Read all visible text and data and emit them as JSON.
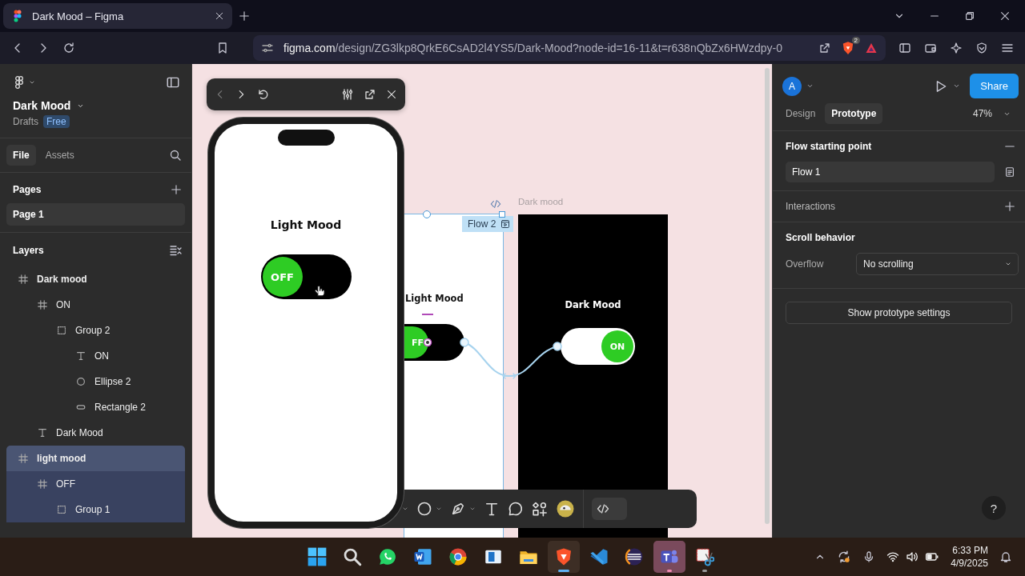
{
  "browser": {
    "tab": {
      "title": "Dark Mood – Figma",
      "selected": true
    },
    "url": {
      "host": "figma.com",
      "path": "/design/ZG3lkp8QrkE6CsAD2l4YS5/Dark-Mood?node-id=16-11&t=r638nQbZx6HWzdpy-0"
    },
    "shield_count": "2"
  },
  "file": {
    "name": "Dark Mood",
    "location": "Drafts",
    "plan": "Free"
  },
  "panel_tabs": [
    {
      "label": "File",
      "selected": true
    },
    {
      "label": "Assets",
      "selected": false
    }
  ],
  "pages": {
    "title": "Pages",
    "items": [
      {
        "label": "Page 1",
        "selected": true
      }
    ]
  },
  "layers": {
    "title": "Layers",
    "items": [
      {
        "kind": "frame",
        "label": "Dark mood",
        "selected": false,
        "children": [
          {
            "kind": "frame",
            "label": "ON",
            "selected": false,
            "children": [
              {
                "kind": "group",
                "label": "Group 2",
                "selected": false,
                "children": [
                  {
                    "kind": "text",
                    "label": "ON",
                    "selected": false
                  },
                  {
                    "kind": "ellipse",
                    "label": "Ellipse 2",
                    "selected": false
                  },
                  {
                    "kind": "rectangle",
                    "label": "Rectangle 2",
                    "selected": false
                  }
                ]
              }
            ]
          },
          {
            "kind": "text",
            "label": "Dark Mood",
            "selected": false
          }
        ]
      },
      {
        "kind": "frame",
        "label": "light mood",
        "selected": true,
        "children": [
          {
            "kind": "frame",
            "label": "OFF",
            "selected": false,
            "children": [
              {
                "kind": "group",
                "label": "Group 1",
                "selected": false
              }
            ]
          }
        ]
      }
    ]
  },
  "canvas": {
    "preview": {
      "title": "Light Mood",
      "toggle": {
        "label": "OFF",
        "on": false
      }
    },
    "dev_mode": {
      "on": false
    },
    "frames": [
      {
        "kind": "light",
        "title": "Light Mood",
        "toggle": {
          "label": "FF",
          "on": false
        },
        "selected": true,
        "flow": "Flow 2"
      },
      {
        "kind": "dark",
        "name": "Dark mood",
        "title": "Dark Mood",
        "toggle": {
          "label": "ON",
          "on": true
        },
        "selected": false
      }
    ]
  },
  "inspector": {
    "avatar": "A",
    "share": "Share",
    "tabs": [
      {
        "label": "Design",
        "selected": false
      },
      {
        "label": "Prototype",
        "selected": true
      }
    ],
    "zoom": "47%",
    "flow_title": "Flow starting point",
    "flows": [
      "Flow 1"
    ],
    "interactions_title": "Interactions",
    "scroll_title": "Scroll behavior",
    "overflow_label": "Overflow",
    "overflow_value": "No scrolling",
    "settings_button": "Show prototype settings",
    "help": "?"
  },
  "taskbar": {
    "apps": [
      {
        "kind": "start",
        "selected": false,
        "running": false,
        "attention": false
      },
      {
        "kind": "search",
        "selected": false,
        "running": false,
        "attention": false
      },
      {
        "kind": "chat",
        "selected": false,
        "running": false,
        "attention": false
      },
      {
        "kind": "document",
        "selected": false,
        "running": false,
        "attention": false
      },
      {
        "kind": "browser",
        "selected": false,
        "running": false,
        "attention": false
      },
      {
        "kind": "window",
        "selected": false,
        "running": false,
        "attention": false
      },
      {
        "kind": "folder",
        "selected": false,
        "running": false,
        "attention": false
      },
      {
        "kind": "shield",
        "selected": true,
        "running": true,
        "attention": false
      },
      {
        "kind": "code",
        "selected": false,
        "running": false,
        "attention": false
      },
      {
        "kind": "sphere",
        "selected": false,
        "running": false,
        "attention": false
      },
      {
        "kind": "team",
        "selected": false,
        "running": true,
        "attention": true
      },
      {
        "kind": "scissors",
        "selected": false,
        "running": true,
        "attention": false
      }
    ],
    "time": "6:33 PM",
    "date": "4/9/2025"
  }
}
